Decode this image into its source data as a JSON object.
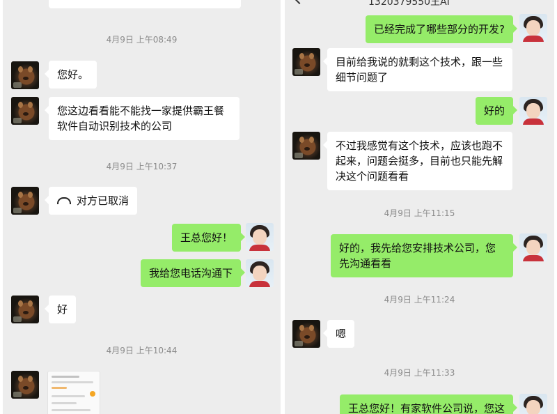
{
  "left": {
    "timestamps": [
      "4月9日 上午08:49",
      "4月9日 上午10:37",
      "4月9日 上午10:44"
    ],
    "messages": [
      {
        "from": "other",
        "text": "您好。"
      },
      {
        "from": "other",
        "text": "您这边看看能不能找一家提供霸王餐软件自动识别技术的公司"
      },
      {
        "from": "other",
        "text": "对方已取消",
        "icon": "phone-hangup-icon"
      },
      {
        "from": "me",
        "text": "王总您好！"
      },
      {
        "from": "me",
        "text": "我给您电话沟通下"
      },
      {
        "from": "other",
        "text": "好"
      },
      {
        "from": "other",
        "type": "image",
        "text": "screenshot-thumbnail"
      }
    ]
  },
  "right": {
    "header_title": "1320379550王AI",
    "timestamps": [
      "4月9日 上午11:15",
      "4月9日 上午11:24",
      "4月9日 上午11:33"
    ],
    "messages": [
      {
        "from": "me",
        "text": "已经完成了哪些部分的开发?"
      },
      {
        "from": "other",
        "text": "目前给我说的就剩这个技术，跟一些细节问题了"
      },
      {
        "from": "me",
        "text": "好的"
      },
      {
        "from": "other",
        "text": "不过我感觉有这个技术，应该也跑不起来，问题会挺多，目前也只能先解决这个问题看看"
      },
      {
        "from": "me",
        "text": "好的，我先给您安排技术公司，您先沟通看看"
      },
      {
        "from": "other",
        "text": "嗯"
      },
      {
        "from": "me",
        "text": "王总您好！有家软件公司说，您这"
      }
    ]
  },
  "colors": {
    "background": "#ededed",
    "my_bubble": "#95ec69",
    "other_bubble": "#ffffff",
    "timestamp": "#8a8a8a"
  }
}
